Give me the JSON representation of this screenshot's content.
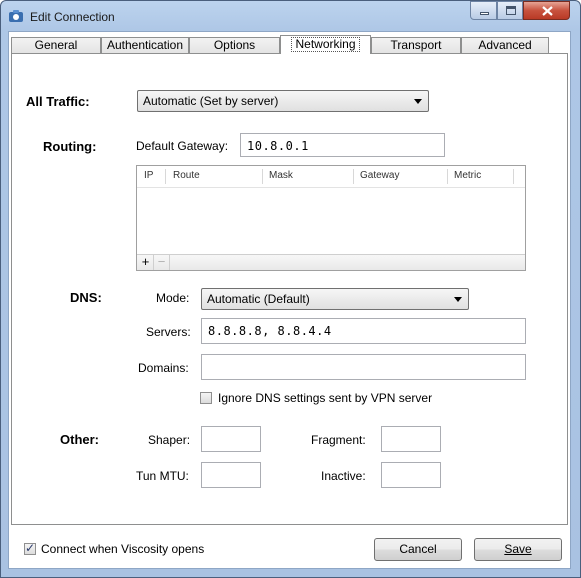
{
  "window": {
    "title": "Edit Connection"
  },
  "tabs": [
    {
      "label": "General"
    },
    {
      "label": "Authentication"
    },
    {
      "label": "Options"
    },
    {
      "label": "Networking",
      "active": true
    },
    {
      "label": "Transport"
    },
    {
      "label": "Advanced"
    }
  ],
  "all_traffic": {
    "label": "All Traffic:",
    "value": "Automatic (Set by server)"
  },
  "routing": {
    "label": "Routing:",
    "gateway_label": "Default Gateway:",
    "gateway_value": "10.8.0.1",
    "columns": [
      "IP",
      "Route",
      "Mask",
      "Gateway",
      "Metric"
    ],
    "rows": [],
    "add_label": "+",
    "remove_label": "−"
  },
  "dns": {
    "label": "DNS:",
    "mode_label": "Mode:",
    "mode_value": "Automatic (Default)",
    "servers_label": "Servers:",
    "servers_value": "8.8.8.8, 8.8.4.4",
    "domains_label": "Domains:",
    "domains_value": "",
    "ignore_label": "Ignore DNS settings sent by VPN server",
    "ignore_checked": false
  },
  "other": {
    "label": "Other:",
    "shaper_label": "Shaper:",
    "shaper_value": "",
    "fragment_label": "Fragment:",
    "fragment_value": "",
    "tunmtu_label": "Tun MTU:",
    "tunmtu_value": "",
    "inactive_label": "Inactive:",
    "inactive_value": ""
  },
  "footer": {
    "connect_label": "Connect when Viscosity opens",
    "connect_checked": true,
    "cancel_label": "Cancel",
    "save_label": "Save"
  },
  "icons": {
    "app": "viscosity-app-icon",
    "minimize": "minimize-icon",
    "maximize": "maximize-icon",
    "close": "close-icon"
  }
}
